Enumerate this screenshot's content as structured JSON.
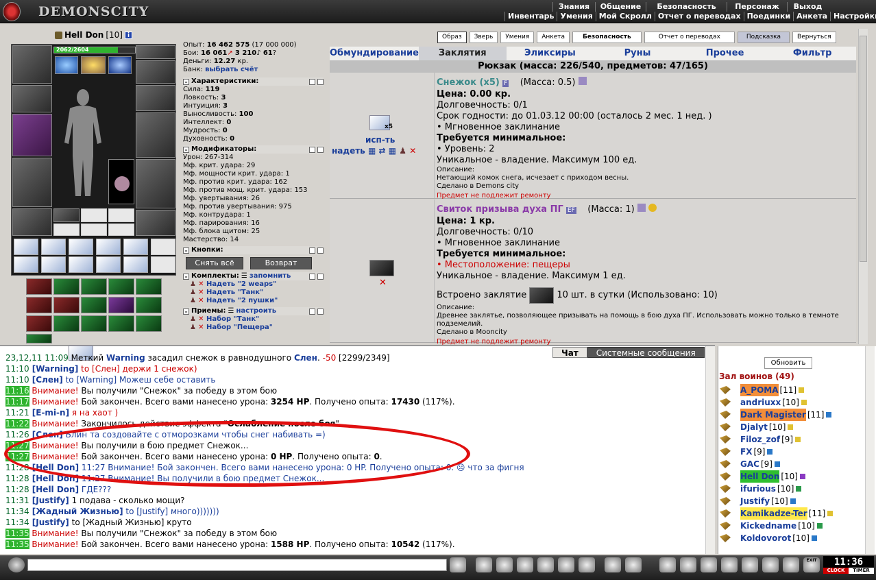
{
  "app": {
    "logo": "DEMONSCITY"
  },
  "topmenu": {
    "row1": [
      "Знания",
      "Общение",
      "Безопасность",
      "Персонаж",
      "Выход"
    ],
    "row2": [
      "Инвентарь",
      "Умения",
      "Мой Скролл",
      "Отчет о переводах",
      "Поединки",
      "Анкета",
      "Настройки"
    ]
  },
  "character": {
    "name": "Hell Don",
    "level": "[10]",
    "hp_text": "2062/2604",
    "hp_fraction": 0.79
  },
  "stats": {
    "exp_label": "Опыт:",
    "exp_value": "16 462 575",
    "exp_next": "(17 000 000)",
    "fights_label": "Бои:",
    "wins": "16 061",
    "losses": "3 210",
    "draws": "61",
    "money_label": "Деньги:",
    "money_value": "12.27",
    "money_unit": "кр.",
    "bank_label": "Банк:",
    "bank_link": "выбрать счёт",
    "char_head": "Характеристики:",
    "chars": [
      {
        "k": "Сила:",
        "v": "119"
      },
      {
        "k": "Ловкость:",
        "v": "3"
      },
      {
        "k": "Интуиция:",
        "v": "3"
      },
      {
        "k": "Выносливость:",
        "v": "100"
      },
      {
        "k": "Интеллект:",
        "v": "0"
      },
      {
        "k": "Мудрость:",
        "v": "0"
      },
      {
        "k": "Духовность:",
        "v": "0"
      }
    ],
    "mod_head": "Модификаторы:",
    "mods": [
      {
        "k": "Урон:",
        "v": "267-314"
      },
      {
        "k": "Мф. крит. удара:",
        "v": "29"
      },
      {
        "k": "Мф. мощности крит. удара:",
        "v": "1"
      },
      {
        "k": "Мф. против крит. удара:",
        "v": "162"
      },
      {
        "k": "Мф. против мощ. крит. удара:",
        "v": "153"
      },
      {
        "k": "Мф. увертывания:",
        "v": "26"
      },
      {
        "k": "Мф. против увертывания:",
        "v": "975"
      },
      {
        "k": "Мф. контрудара:",
        "v": "1"
      },
      {
        "k": "Мф. парирования:",
        "v": "16"
      },
      {
        "k": "Мф. блока щитом:",
        "v": "25"
      },
      {
        "k": "Мастерство:",
        "v": "14"
      }
    ],
    "buttons_head": "Кнопки:",
    "btn_remove": "Снять всё",
    "btn_return": "Возврат",
    "sets_head": "Комплекты:",
    "sets_remember": "запомнить",
    "sets": [
      "Надеть \"2 weaps\"",
      "Надеть \"Танк\"",
      "Надеть \"2 пушки\""
    ],
    "tricks_head": "Приемы:",
    "tricks_setup": "настроить",
    "tricks": [
      "Набор \"Танк\"",
      "Набор \"Пещера\""
    ]
  },
  "toptabs": [
    "Образ",
    "Зверь",
    "Умения",
    "Анкета",
    "Безопасность",
    "Отчет о переводах",
    "Подсказка",
    "Вернуться"
  ],
  "cattabs": [
    "Обмундирование",
    "Заклятия",
    "Эликсиры",
    "Руны",
    "Прочее",
    "Фильтр"
  ],
  "backpack": "Рюкзак (масса: 226/540, предметов: 47/165)",
  "items": [
    {
      "count_badge": "x5",
      "use": "исп-ть",
      "wear": "надеть",
      "name": "Снежок (x5)",
      "mass": "(Масса: 0.5)",
      "price": "Цена: 0.00 кр.",
      "dur": "Долговечность: 0/1",
      "expire": "Срок годности: до 01.03.12 00:00 (осталось 2 мес. 1 нед. )",
      "instant": "• Мгновенное заклинание",
      "req_head": "Требуется минимальное:",
      "req": "• Уровень: 2",
      "unique": "Уникальное - владение. Максимум 100 ед.",
      "desc_head": "Описание:",
      "desc": "Нетающий комок снега, исчезает с приходом весны.",
      "made": "Сделано в Demons city",
      "norepair": "Предмет не подлежит ремонту"
    },
    {
      "name": "Свиток призыва духа ПГ",
      "mass": "(Масса: 1)",
      "price": "Цена: 1 кр.",
      "dur": "Долговечность: 0/10",
      "instant": "• Мгновенное заклинание",
      "req_head": "Требуется минимальное:",
      "req": "• Местоположение: пещеры",
      "unique": "Уникальное - владение. Максимум 1 ед.",
      "embed_label": "Встроено заклятие",
      "embed_text": "10 шт. в сутки (Использовано: 10)",
      "desc_head": "Описание:",
      "desc": "Древнее заклятье, позволяющее призывать на помощь в бою духа ПГ. Использовать можно только в темноте подземелий.",
      "made": "Сделано в Mooncity",
      "norepair": "Предмет не подлежит ремонту"
    }
  ],
  "chat": {
    "tab_chat": "Чат",
    "tab_system": "Системные сообщения",
    "lines": [
      {
        "time": "23,12,11 11:09",
        "type": "plain",
        "parts": [
          [
            "dark",
            " Меткий "
          ],
          [
            "nick",
            "Warning"
          ],
          [
            "dark",
            " засадил снежок в равнодушного "
          ],
          [
            "nick",
            "Слен"
          ],
          [
            "dark",
            ". "
          ],
          [
            "redw",
            "-50"
          ],
          [
            "dark",
            " [2299/2349]"
          ]
        ]
      },
      {
        "time": "11:10",
        "type": "plain",
        "parts": [
          [
            "nick",
            " [Warning]"
          ],
          [
            "redw",
            " to [Слен] держи 1 снежок)"
          ]
        ]
      },
      {
        "time": "11:10",
        "type": "plain",
        "parts": [
          [
            "nick",
            " [Слен]"
          ],
          [
            "blue",
            " to [Warning] Можеш себе оставить"
          ]
        ]
      },
      {
        "time": "11:16",
        "type": "sys",
        "parts": [
          [
            "redw",
            " Внимание!"
          ],
          [
            "dark",
            " Вы получили \"Снежок\" за победу в этом бою"
          ]
        ]
      },
      {
        "time": "11:17",
        "type": "sys",
        "parts": [
          [
            "redw",
            " Внимание!"
          ],
          [
            "dark",
            " Бой закончен. Всего вами нанесено урона: "
          ],
          [
            "b",
            "3254 HP"
          ],
          [
            "dark",
            ". Получено опыта: "
          ],
          [
            "b",
            "17430"
          ],
          [
            "dark",
            " (117%)."
          ]
        ]
      },
      {
        "time": "11:21",
        "type": "plain",
        "parts": [
          [
            "nick",
            " [E-mi-n]"
          ],
          [
            "redw",
            " я на хаот )"
          ]
        ]
      },
      {
        "time": "11:22",
        "type": "sys",
        "parts": [
          [
            "redw",
            " Внимание!"
          ],
          [
            "dark",
            " Закончилось действие эффекта \""
          ],
          [
            "b",
            "Ослабление после боя"
          ],
          [
            "dark",
            "\"."
          ]
        ]
      },
      {
        "time": "11:26",
        "type": "plain",
        "parts": [
          [
            "nick",
            " [Слен]"
          ],
          [
            "blue",
            " Блин та создовайте с отморозками чтобы снег набивать =)"
          ]
        ]
      },
      {
        "time": "11:27",
        "type": "sys",
        "parts": [
          [
            "redw",
            " Внимание!"
          ],
          [
            "dark",
            " Вы получили в бою предмет Снежок..."
          ]
        ]
      },
      {
        "time": "11:27",
        "type": "sys",
        "parts": [
          [
            "redw",
            " Внимание!"
          ],
          [
            "dark",
            " Бой закончен. Всего вами нанесено урона: "
          ],
          [
            "b",
            "0 HP"
          ],
          [
            "dark",
            ". Получено опыта: "
          ],
          [
            "b",
            "0"
          ],
          [
            "dark",
            "."
          ]
        ]
      },
      {
        "time": "11:28",
        "type": "plain",
        "parts": [
          [
            "nick",
            " [Hell Don]"
          ],
          [
            "blue",
            " 11:27 Внимание! Бой закончен. Всего вами нанесено урона: 0 HP. Получено опыта: 0."
          ],
          [
            "blue",
            " ☹ что за фигня"
          ]
        ]
      },
      {
        "time": "11:28",
        "type": "plain",
        "parts": [
          [
            "nick",
            " [Hell Don]"
          ],
          [
            "blue",
            " 11:27 Внимание! Вы получили в бою предмет Снежок..."
          ]
        ]
      },
      {
        "time": "11:28",
        "type": "plain",
        "parts": [
          [
            "nick",
            " [Hell Don]"
          ],
          [
            "blue",
            " ГДЕ???"
          ]
        ]
      },
      {
        "time": "11:31",
        "type": "plain",
        "parts": [
          [
            "nick",
            " [Justify]"
          ],
          [
            "dark",
            " 1 подава - сколько мощи?"
          ]
        ]
      },
      {
        "time": "11:34",
        "type": "plain",
        "parts": [
          [
            "nick",
            " [Жадный Жизнью]"
          ],
          [
            "blue",
            " to [Justify] много)))))))"
          ]
        ]
      },
      {
        "time": "11:34",
        "type": "plain",
        "parts": [
          [
            "nick",
            " [Justify]"
          ],
          [
            "dark",
            " to [Жадный Жизнью] круто"
          ]
        ]
      },
      {
        "time": "11:35",
        "type": "sys",
        "parts": [
          [
            "redw",
            " Внимание!"
          ],
          [
            "dark",
            " Вы получили \"Снежок\" за победу в этом бою"
          ]
        ]
      },
      {
        "time": "11:35",
        "type": "sys",
        "parts": [
          [
            "redw",
            " Внимание!"
          ],
          [
            "dark",
            " Бой закончен. Всего вами нанесено урона: "
          ],
          [
            "b",
            "1588 HP"
          ],
          [
            "dark",
            ". Получено опыта: "
          ],
          [
            "b",
            "10542"
          ],
          [
            "dark",
            " (117%)."
          ]
        ]
      }
    ]
  },
  "hall": {
    "refresh": "Обновить",
    "title": "Зал воинов (49)",
    "players": [
      {
        "name": "A_POMA",
        "lvl": "[11]",
        "hl": "orange",
        "icon": "y"
      },
      {
        "name": "andriuxx",
        "lvl": "[10]",
        "hl": "",
        "icon": "y"
      },
      {
        "name": "Dark Magister",
        "lvl": "[11]",
        "hl": "orange",
        "icon": "b"
      },
      {
        "name": "Djalyt",
        "lvl": "[10]",
        "hl": "",
        "icon": "y"
      },
      {
        "name": "Filoz_zof",
        "lvl": "[9]",
        "hl": "",
        "icon": "y"
      },
      {
        "name": "FX",
        "lvl": "[9]",
        "hl": "",
        "icon": "b"
      },
      {
        "name": "GAC",
        "lvl": "[9]",
        "hl": "",
        "icon": "b"
      },
      {
        "name": "Hell Don",
        "lvl": "[10]",
        "hl": "green",
        "icon": "p"
      },
      {
        "name": "ifurious",
        "lvl": "[10]",
        "hl": "",
        "icon": "i"
      },
      {
        "name": "Justify",
        "lvl": "[10]",
        "hl": "",
        "icon": "b"
      },
      {
        "name": "Kamikadze-Ter",
        "lvl": "[11]",
        "hl": "yellow",
        "icon": "y"
      },
      {
        "name": "Kickedname",
        "lvl": "[10]",
        "hl": "",
        "icon": "i"
      },
      {
        "name": "Koldovorot",
        "lvl": "[10]",
        "hl": "",
        "icon": "b"
      }
    ]
  },
  "clock": {
    "time": "11:36",
    "clock_label": "CLOCK",
    "timer_label": "TIMER",
    "exit_label": "EXIT"
  }
}
